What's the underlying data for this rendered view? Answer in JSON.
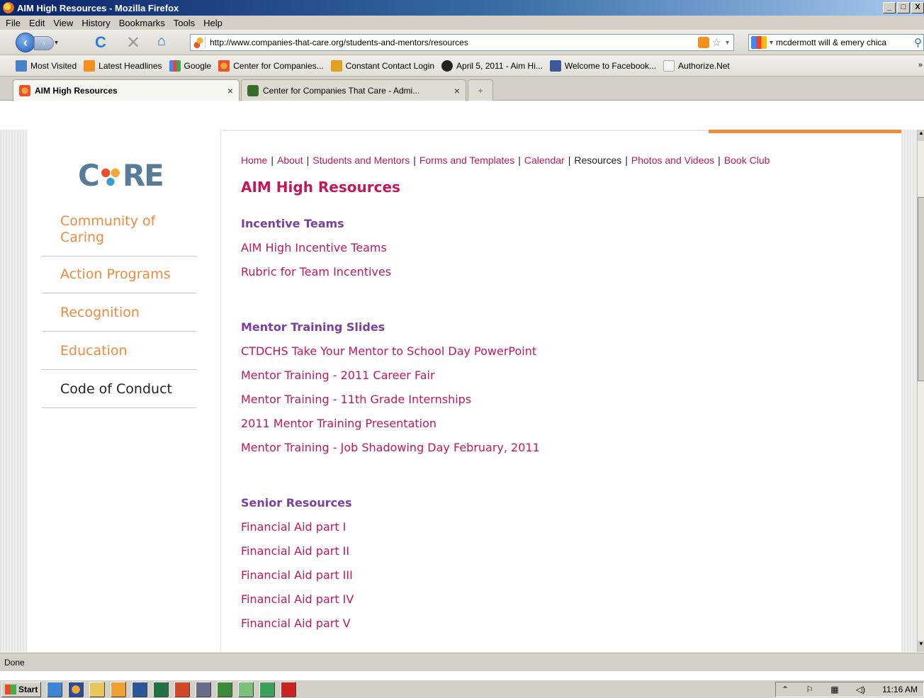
{
  "window": {
    "title": "AIM High Resources - Mozilla Firefox",
    "controls": [
      "_",
      "□",
      "X"
    ]
  },
  "menu": [
    "File",
    "Edit",
    "View",
    "History",
    "Bookmarks",
    "Tools",
    "Help"
  ],
  "navbar": {
    "url": "http://www.companies-that-care.org/students-and-mentors/resources",
    "search_value": "mcdermott will & emery chica"
  },
  "bookmarks": [
    {
      "label": "Most Visited",
      "color": "#4a7fc9"
    },
    {
      "label": "Latest Headlines",
      "color": "#f39021"
    },
    {
      "label": "Google",
      "color": "#4285f4"
    },
    {
      "label": "Center for Companies...",
      "color": "#f3a736"
    },
    {
      "label": "Constant Contact Login",
      "color": "#e0a020"
    },
    {
      "label": "April 5, 2011 - Aim Hi...",
      "color": "#222222"
    },
    {
      "label": "Welcome to Facebook...",
      "color": "#3b5998"
    },
    {
      "label": "Authorize.Net",
      "color": "#f5f5f5"
    }
  ],
  "tabs": {
    "active": "AIM High Resources",
    "inactive": "Center for Companies That Care - Admi...",
    "close": "×",
    "new_tab": "+"
  },
  "site": {
    "logo_left": "C",
    "logo_right": "RE",
    "sidebar": [
      "Community of Caring",
      "Action Programs",
      "Recognition",
      "Education",
      "Code of Conduct"
    ],
    "topnav": [
      "Home",
      "About",
      "Students and Mentors",
      "Forms and Templates",
      "Calendar",
      "Resources",
      "Photos and Videos",
      "Book Club"
    ],
    "page_title": "AIM High Resources",
    "sections": [
      {
        "title": "Incentive Teams",
        "links": [
          "AIM High Incentive Teams",
          "Rubric for Team Incentives"
        ]
      },
      {
        "title": "Mentor Training Slides",
        "links": [
          "CTDCHS Take Your Mentor to School Day PowerPoint",
          "Mentor Training - 2011 Career Fair",
          "Mentor Training - 11th Grade Internships",
          "2011 Mentor Training Presentation",
          "Mentor Training - Job Shadowing Day February, 2011"
        ]
      },
      {
        "title": "Senior Resources",
        "links": [
          "Financial Aid part I",
          "Financial Aid part II",
          "Financial Aid part III",
          "Financial Aid part IV",
          "Financial Aid part V"
        ]
      }
    ],
    "colors": {
      "accent": "#c2185b",
      "section": "#7b3fa1",
      "sidebar": "#f08a3c"
    }
  },
  "status": "Done",
  "taskbar": {
    "start": "Start",
    "clock": "11:16 AM"
  }
}
